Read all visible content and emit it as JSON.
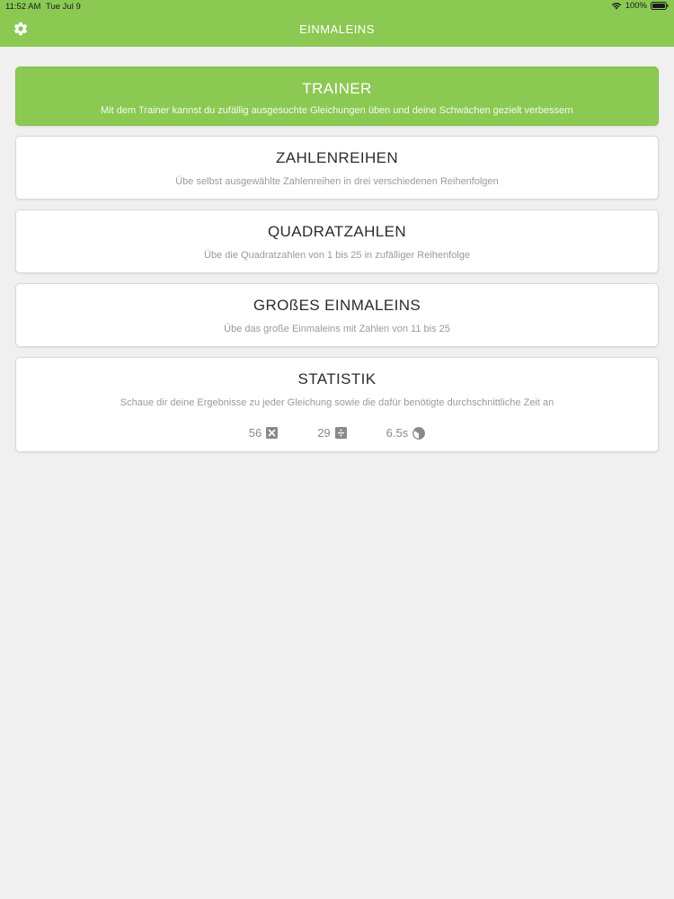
{
  "status_bar": {
    "time": "11:52 AM",
    "date": "Tue Jul 9",
    "battery": "100%"
  },
  "nav": {
    "title": "EINMALEINS",
    "settings_icon": "gear-icon"
  },
  "colors": {
    "accent": "#8bc953",
    "background": "#f1f0f0"
  },
  "cards": {
    "trainer": {
      "title": "TRAINER",
      "description": "Mit dem Trainer kannst du zufällig ausgesuchte Gleichungen üben und deine Schwächen gezielt verbessern"
    },
    "zahlenreihen": {
      "title": "ZAHLENREIHEN",
      "description": "Übe selbst ausgewählte Zahlenreihen in drei verschiedenen Reihenfolgen"
    },
    "quadratzahlen": {
      "title": "QUADRATZAHLEN",
      "description": "Übe die Quadratzahlen von 1 bis 25 in zufälliger Reihenfolge"
    },
    "grosses": {
      "title": "GROßES EINMALEINS",
      "description": "Übe das große Einmaleins mit Zahlen von 11 bis 25"
    },
    "statistik": {
      "title": "STATISTIK",
      "description": "Schaue dir deine Ergebnisse zu jeder Gleichung sowie die dafür benötigte durchschnittliche Zeit an",
      "stats": {
        "multiply_count": "56",
        "divide_count": "29",
        "avg_time": "6.5s"
      }
    }
  }
}
